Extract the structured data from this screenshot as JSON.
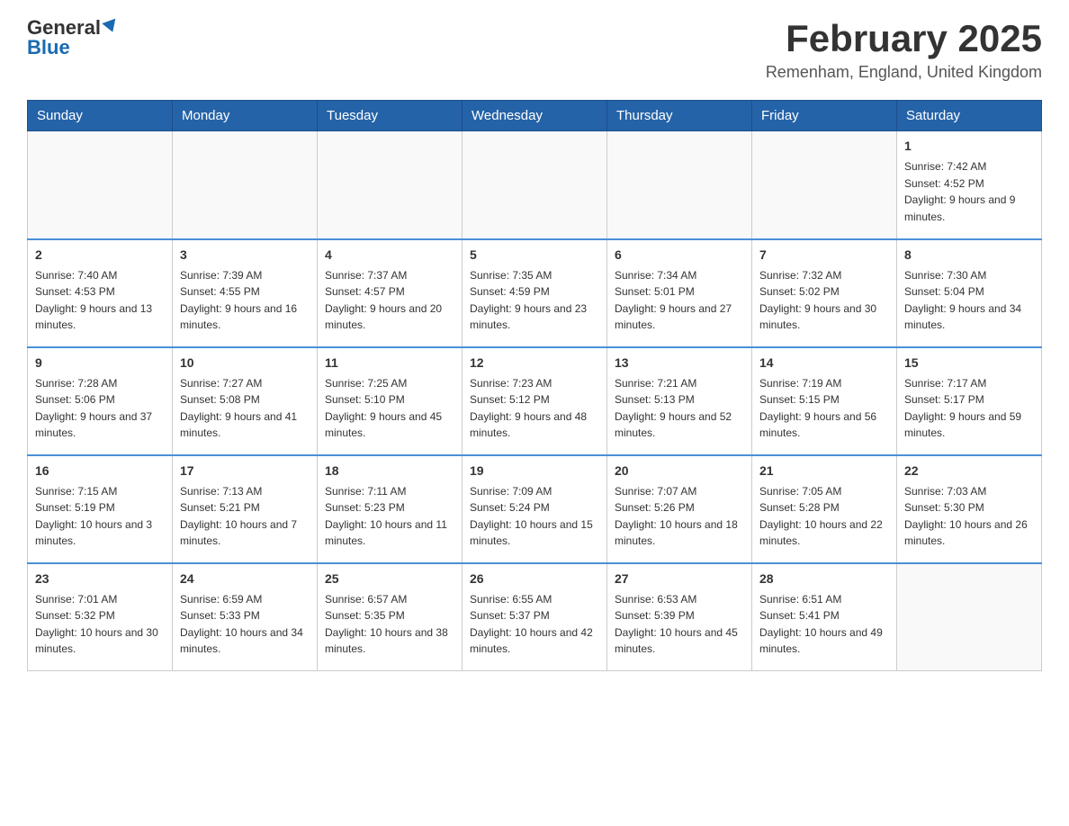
{
  "header": {
    "logo_general": "General",
    "logo_blue": "Blue",
    "month_title": "February 2025",
    "location": "Remenham, England, United Kingdom"
  },
  "weekdays": [
    "Sunday",
    "Monday",
    "Tuesday",
    "Wednesday",
    "Thursday",
    "Friday",
    "Saturday"
  ],
  "weeks": [
    [
      {
        "day": "",
        "sunrise": "",
        "sunset": "",
        "daylight": ""
      },
      {
        "day": "",
        "sunrise": "",
        "sunset": "",
        "daylight": ""
      },
      {
        "day": "",
        "sunrise": "",
        "sunset": "",
        "daylight": ""
      },
      {
        "day": "",
        "sunrise": "",
        "sunset": "",
        "daylight": ""
      },
      {
        "day": "",
        "sunrise": "",
        "sunset": "",
        "daylight": ""
      },
      {
        "day": "",
        "sunrise": "",
        "sunset": "",
        "daylight": ""
      },
      {
        "day": "1",
        "sunrise": "Sunrise: 7:42 AM",
        "sunset": "Sunset: 4:52 PM",
        "daylight": "Daylight: 9 hours and 9 minutes."
      }
    ],
    [
      {
        "day": "2",
        "sunrise": "Sunrise: 7:40 AM",
        "sunset": "Sunset: 4:53 PM",
        "daylight": "Daylight: 9 hours and 13 minutes."
      },
      {
        "day": "3",
        "sunrise": "Sunrise: 7:39 AM",
        "sunset": "Sunset: 4:55 PM",
        "daylight": "Daylight: 9 hours and 16 minutes."
      },
      {
        "day": "4",
        "sunrise": "Sunrise: 7:37 AM",
        "sunset": "Sunset: 4:57 PM",
        "daylight": "Daylight: 9 hours and 20 minutes."
      },
      {
        "day": "5",
        "sunrise": "Sunrise: 7:35 AM",
        "sunset": "Sunset: 4:59 PM",
        "daylight": "Daylight: 9 hours and 23 minutes."
      },
      {
        "day": "6",
        "sunrise": "Sunrise: 7:34 AM",
        "sunset": "Sunset: 5:01 PM",
        "daylight": "Daylight: 9 hours and 27 minutes."
      },
      {
        "day": "7",
        "sunrise": "Sunrise: 7:32 AM",
        "sunset": "Sunset: 5:02 PM",
        "daylight": "Daylight: 9 hours and 30 minutes."
      },
      {
        "day": "8",
        "sunrise": "Sunrise: 7:30 AM",
        "sunset": "Sunset: 5:04 PM",
        "daylight": "Daylight: 9 hours and 34 minutes."
      }
    ],
    [
      {
        "day": "9",
        "sunrise": "Sunrise: 7:28 AM",
        "sunset": "Sunset: 5:06 PM",
        "daylight": "Daylight: 9 hours and 37 minutes."
      },
      {
        "day": "10",
        "sunrise": "Sunrise: 7:27 AM",
        "sunset": "Sunset: 5:08 PM",
        "daylight": "Daylight: 9 hours and 41 minutes."
      },
      {
        "day": "11",
        "sunrise": "Sunrise: 7:25 AM",
        "sunset": "Sunset: 5:10 PM",
        "daylight": "Daylight: 9 hours and 45 minutes."
      },
      {
        "day": "12",
        "sunrise": "Sunrise: 7:23 AM",
        "sunset": "Sunset: 5:12 PM",
        "daylight": "Daylight: 9 hours and 48 minutes."
      },
      {
        "day": "13",
        "sunrise": "Sunrise: 7:21 AM",
        "sunset": "Sunset: 5:13 PM",
        "daylight": "Daylight: 9 hours and 52 minutes."
      },
      {
        "day": "14",
        "sunrise": "Sunrise: 7:19 AM",
        "sunset": "Sunset: 5:15 PM",
        "daylight": "Daylight: 9 hours and 56 minutes."
      },
      {
        "day": "15",
        "sunrise": "Sunrise: 7:17 AM",
        "sunset": "Sunset: 5:17 PM",
        "daylight": "Daylight: 9 hours and 59 minutes."
      }
    ],
    [
      {
        "day": "16",
        "sunrise": "Sunrise: 7:15 AM",
        "sunset": "Sunset: 5:19 PM",
        "daylight": "Daylight: 10 hours and 3 minutes."
      },
      {
        "day": "17",
        "sunrise": "Sunrise: 7:13 AM",
        "sunset": "Sunset: 5:21 PM",
        "daylight": "Daylight: 10 hours and 7 minutes."
      },
      {
        "day": "18",
        "sunrise": "Sunrise: 7:11 AM",
        "sunset": "Sunset: 5:23 PM",
        "daylight": "Daylight: 10 hours and 11 minutes."
      },
      {
        "day": "19",
        "sunrise": "Sunrise: 7:09 AM",
        "sunset": "Sunset: 5:24 PM",
        "daylight": "Daylight: 10 hours and 15 minutes."
      },
      {
        "day": "20",
        "sunrise": "Sunrise: 7:07 AM",
        "sunset": "Sunset: 5:26 PM",
        "daylight": "Daylight: 10 hours and 18 minutes."
      },
      {
        "day": "21",
        "sunrise": "Sunrise: 7:05 AM",
        "sunset": "Sunset: 5:28 PM",
        "daylight": "Daylight: 10 hours and 22 minutes."
      },
      {
        "day": "22",
        "sunrise": "Sunrise: 7:03 AM",
        "sunset": "Sunset: 5:30 PM",
        "daylight": "Daylight: 10 hours and 26 minutes."
      }
    ],
    [
      {
        "day": "23",
        "sunrise": "Sunrise: 7:01 AM",
        "sunset": "Sunset: 5:32 PM",
        "daylight": "Daylight: 10 hours and 30 minutes."
      },
      {
        "day": "24",
        "sunrise": "Sunrise: 6:59 AM",
        "sunset": "Sunset: 5:33 PM",
        "daylight": "Daylight: 10 hours and 34 minutes."
      },
      {
        "day": "25",
        "sunrise": "Sunrise: 6:57 AM",
        "sunset": "Sunset: 5:35 PM",
        "daylight": "Daylight: 10 hours and 38 minutes."
      },
      {
        "day": "26",
        "sunrise": "Sunrise: 6:55 AM",
        "sunset": "Sunset: 5:37 PM",
        "daylight": "Daylight: 10 hours and 42 minutes."
      },
      {
        "day": "27",
        "sunrise": "Sunrise: 6:53 AM",
        "sunset": "Sunset: 5:39 PM",
        "daylight": "Daylight: 10 hours and 45 minutes."
      },
      {
        "day": "28",
        "sunrise": "Sunrise: 6:51 AM",
        "sunset": "Sunset: 5:41 PM",
        "daylight": "Daylight: 10 hours and 49 minutes."
      },
      {
        "day": "",
        "sunrise": "",
        "sunset": "",
        "daylight": ""
      }
    ]
  ]
}
